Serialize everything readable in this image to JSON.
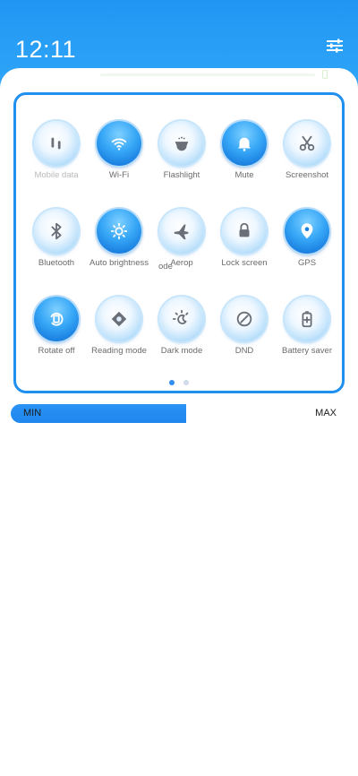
{
  "status": {
    "time": "12:11"
  },
  "header": {
    "settings_icon": "sliders-icon"
  },
  "tiles": [
    {
      "label": "Mobile data",
      "state": "off",
      "icon": "mobile-data-icon",
      "dim": true
    },
    {
      "label": "Wi-Fi",
      "state": "on",
      "icon": "wifi-icon"
    },
    {
      "label": "Flashlight",
      "state": "off",
      "icon": "flashlight-icon"
    },
    {
      "label": "Mute",
      "state": "on",
      "icon": "bell-icon"
    },
    {
      "label": "Screenshot",
      "state": "off",
      "icon": "scissors-icon"
    },
    {
      "label": "Bluetooth",
      "state": "off",
      "icon": "bluetooth-icon"
    },
    {
      "label": "Auto brightness",
      "state": "on",
      "icon": "brightness-icon"
    },
    {
      "label": "Aerop",
      "state": "off",
      "icon": "airplane-icon"
    },
    {
      "label": "Lock screen",
      "state": "off",
      "icon": "lock-icon"
    },
    {
      "label": "GPS",
      "state": "on",
      "icon": "location-pin-icon"
    },
    {
      "label": "Rotate off",
      "state": "on",
      "icon": "rotate-lock-icon"
    },
    {
      "label": "Reading mode",
      "state": "off",
      "icon": "reading-mode-icon"
    },
    {
      "label": "Dark mode",
      "state": "off",
      "icon": "dark-mode-icon"
    },
    {
      "label": "DND",
      "state": "off",
      "icon": "dnd-icon"
    },
    {
      "label": "Battery saver",
      "state": "off",
      "icon": "battery-saver-icon"
    }
  ],
  "overflow_text": "ode",
  "pager": {
    "pages": 2,
    "current": 1
  },
  "brightness": {
    "min_label": "MIN",
    "max_label": "MAX",
    "level": 0.52
  }
}
